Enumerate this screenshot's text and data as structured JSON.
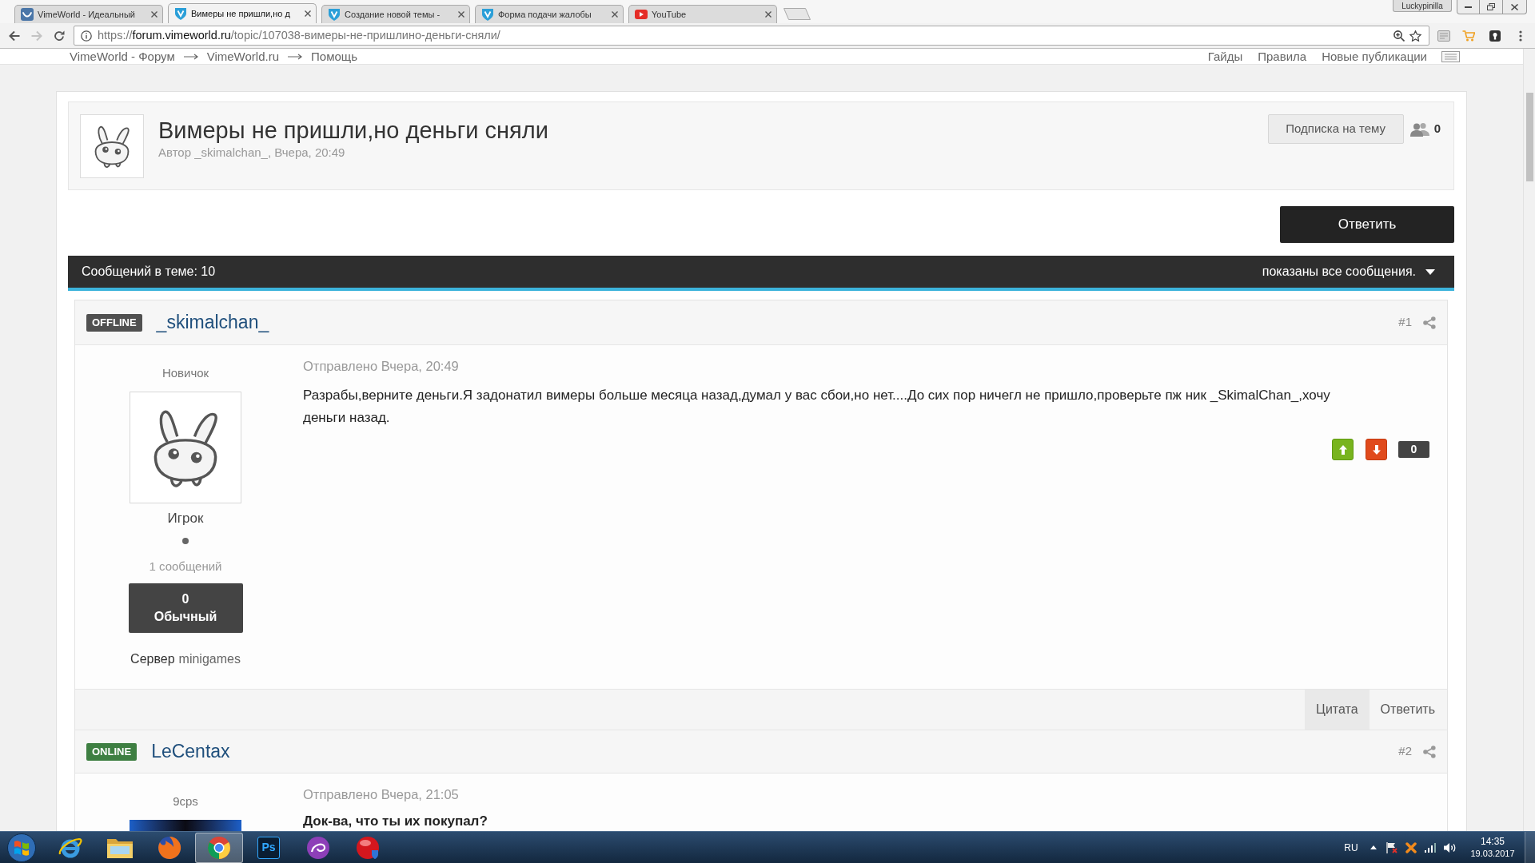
{
  "browser": {
    "tabs": [
      {
        "title": "VimeWorld - Идеальный",
        "kind": "square",
        "selected": false
      },
      {
        "title": "Вимеры не пришли,но д",
        "kind": "shield",
        "selected": true
      },
      {
        "title": "Создание новой темы -",
        "kind": "shield",
        "selected": false
      },
      {
        "title": "Форма подачи жалобы",
        "kind": "shield",
        "selected": false
      },
      {
        "title": "YouTube",
        "kind": "play",
        "selected": false
      }
    ],
    "profile": "Luckypinilla",
    "can_go_forward": false,
    "address": {
      "scheme": "https://",
      "host": "forum.vimeworld.ru",
      "path": "/topic/107038-вимеры-не-пришлино-деньги-сняли/"
    }
  },
  "nav": {
    "breadcrumbs": [
      "VimeWorld - Форум",
      "VimeWorld.ru",
      "Помощь"
    ],
    "links": [
      "Гайды",
      "Правила",
      "Новые публикации"
    ]
  },
  "topic": {
    "title": "Вимеры не пришли,но деньги сняли",
    "byline": "Автор _skimalchan_, Вчера, 20:49",
    "follow_button": "Подписка на тему",
    "followers": "0",
    "reply_button": "Ответить"
  },
  "posts_bar": {
    "count": "Сообщений в теме: 10",
    "filter": "показаны все сообщения."
  },
  "posts": [
    {
      "online": false,
      "status": "OFFLINE",
      "author": "_skimalchan_",
      "number": "#1",
      "rank": "Новичок",
      "avatar": {
        "kind": "creature"
      },
      "group": "Игрок",
      "post_count": "1 сообщений",
      "reputation": {
        "value": "0",
        "label": "Обычный"
      },
      "server": {
        "label": "Сервер",
        "value": "minigames"
      },
      "posted": "Отправлено Вчера, 20:49",
      "body": "Разрабы,верните деньги.Я задонатил вимеры больше месяца назад,думал у вас сбои,но нет....До сих пор ничегл не пришло,проверьте пж ник _SkimalChan_,хочу деньги назад.",
      "bold": false,
      "votes": "0",
      "actions": [
        {
          "label": "Цитата",
          "hovered": true
        },
        {
          "label": "Ответить",
          "hovered": false
        }
      ]
    },
    {
      "online": true,
      "status": "ONLINE",
      "author": "LeCentax",
      "number": "#2",
      "rank": "9cps",
      "avatar": {
        "kind": "image"
      },
      "posted": "Отправлено Вчера, 21:05",
      "body": "Док-ва, что ты их покупал?",
      "bold": true
    }
  ],
  "taskbar": {
    "apps": [
      {
        "kind": "orbit",
        "selected": false
      },
      {
        "kind": "folder",
        "selected": false
      },
      {
        "kind": "globe",
        "selected": false
      },
      {
        "kind": "wheel",
        "selected": true
      },
      {
        "kind": "tile",
        "label": "Ps",
        "selected": false
      },
      {
        "kind": "swirl",
        "selected": false
      },
      {
        "kind": "ball",
        "selected": false
      }
    ],
    "language": "RU",
    "time": "14:35",
    "date": "19.03.2017"
  }
}
